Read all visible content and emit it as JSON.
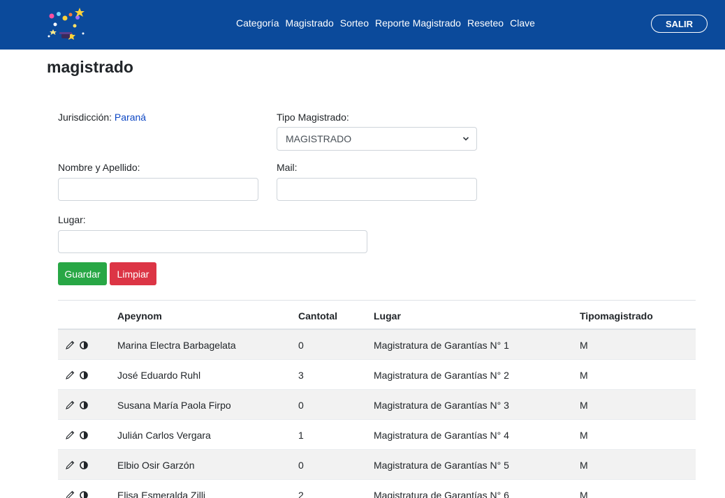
{
  "nav": {
    "links": [
      "Categoría",
      "Magistrado",
      "Sorteo",
      "Reporte Magistrado",
      "Reseteo",
      "Clave"
    ],
    "logout_label": "SALIR"
  },
  "page": {
    "title": "magistrado"
  },
  "form": {
    "jurisdiccion_label": "Jurisdicción:",
    "jurisdiccion_value": "Paraná",
    "tipo_label": "Tipo Magistrado:",
    "tipo_selected": "MAGISTRADO",
    "nombre_label": "Nombre y Apellido:",
    "nombre_value": "",
    "mail_label": "Mail:",
    "mail_value": "",
    "lugar_label": "Lugar:",
    "lugar_value": "",
    "guardar_label": "Guardar",
    "limpiar_label": "Limpiar"
  },
  "table": {
    "headers": [
      "Apeynom",
      "Cantotal",
      "Lugar",
      "Tipomagistrado"
    ],
    "rows": [
      {
        "apeynom": "Marina Electra Barbagelata",
        "cantotal": "0",
        "lugar": "Magistratura de Garantías N° 1",
        "tipo": "M"
      },
      {
        "apeynom": "José Eduardo Ruhl",
        "cantotal": "3",
        "lugar": "Magistratura de Garantías N° 2",
        "tipo": "M"
      },
      {
        "apeynom": "Susana María Paola Firpo",
        "cantotal": "0",
        "lugar": "Magistratura de Garantías N° 3",
        "tipo": "M"
      },
      {
        "apeynom": "Julián Carlos Vergara",
        "cantotal": "1",
        "lugar": "Magistratura de Garantías N° 4",
        "tipo": "M"
      },
      {
        "apeynom": "Elbio Osir Garzón",
        "cantotal": "0",
        "lugar": "Magistratura de Garantías N° 5",
        "tipo": "M"
      },
      {
        "apeynom": "Elisa Esmeralda Zilli",
        "cantotal": "2",
        "lugar": "Magistratura de Garantías N° 6",
        "tipo": "M"
      }
    ]
  },
  "colors": {
    "navbar": "#0b4a9b",
    "success": "#28a745",
    "danger": "#dc3545",
    "link": "#0d47c4"
  },
  "icons": [
    "app-logo-icon",
    "pencil-icon",
    "toggle-icon",
    "chevron-down-icon"
  ]
}
